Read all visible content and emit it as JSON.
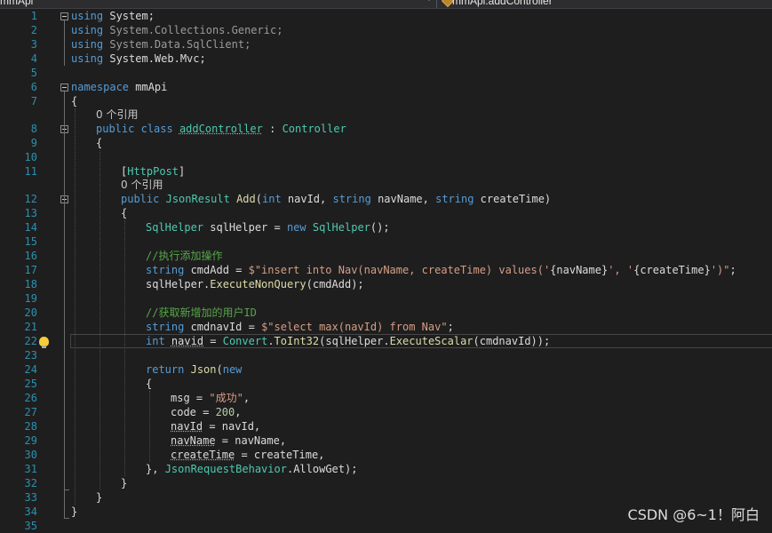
{
  "navbar": {
    "project_dropdown": "mmApi",
    "class_dropdown": "mmApi.addController"
  },
  "editor": {
    "line_numbers": [
      "1",
      "2",
      "3",
      "4",
      "5",
      "6",
      "7",
      "8",
      "9",
      "10",
      "11",
      "12",
      "13",
      "14",
      "15",
      "16",
      "17",
      "18",
      "19",
      "20",
      "21",
      "22",
      "23",
      "24",
      "25",
      "26",
      "27",
      "28",
      "29",
      "30",
      "31",
      "32",
      "33",
      "34",
      "35"
    ],
    "codelens_class": "0 个引用",
    "codelens_method": "0 个引用",
    "lines": {
      "l1": [
        "using",
        " System;"
      ],
      "l2": [
        "using",
        " System.Collections.Generic;"
      ],
      "l3": [
        "using",
        " System.Data.SqlClient;"
      ],
      "l4": [
        "using",
        " System.Web.Mvc;"
      ],
      "l6": [
        "namespace",
        " mmApi"
      ],
      "l7": "{",
      "l8": [
        "public",
        " ",
        "class",
        " ",
        "addController",
        " : ",
        "Controller"
      ],
      "l9": "{",
      "l11": [
        "[",
        "HttpPost",
        "]"
      ],
      "l12": [
        "public",
        " ",
        "JsonResult",
        " ",
        "Add",
        "(",
        "int",
        " navId, ",
        "string",
        " navName, ",
        "string",
        " createTime)"
      ],
      "l13": "{",
      "l14": [
        "SqlHelper",
        " sqlHelper = ",
        "new",
        " ",
        "SqlHelper",
        "();"
      ],
      "l16": "//执行添加操作",
      "l17": [
        "string",
        " cmdAdd = ",
        "$\"insert into Nav(navName, createTime) values('",
        "{navName}",
        "', '",
        "{createTime}",
        "')\"",
        ";"
      ],
      "l18": [
        "sqlHelper.",
        "ExecuteNonQuery",
        "(cmdAdd);"
      ],
      "l20": "//获取新增加的用户ID",
      "l21": [
        "string",
        " cmdnavId = ",
        "$\"select max(navId) from Nav\"",
        ";"
      ],
      "l22": [
        "int",
        " ",
        "navid",
        " = ",
        "Convert",
        ".",
        "ToInt32",
        "(sqlHelper.",
        "ExecuteScalar",
        "(cmdnavId));"
      ],
      "l24": [
        "return",
        " ",
        "Json",
        "(",
        "new"
      ],
      "l25": "{",
      "l26": [
        "msg = ",
        "\"成功\"",
        ","
      ],
      "l27": [
        "code = ",
        "200",
        ","
      ],
      "l28": [
        "navId",
        " = navId,"
      ],
      "l29": [
        "navName",
        " = navName,"
      ],
      "l30": [
        "createTime",
        " = createTime,"
      ],
      "l31": [
        "}, ",
        "JsonRequestBehavior",
        ".AllowGet);"
      ],
      "l32": "}",
      "l33": "}",
      "l34": "}"
    },
    "current_line": "22"
  },
  "watermark": "CSDN @6~1！阿白",
  "colors": {
    "background": "#1e1e1e",
    "line_number": "#2b91af",
    "keyword": "#569cd6",
    "type": "#4ec9b0",
    "method": "#dcdcaa",
    "string": "#d69d85",
    "comment": "#57a64a",
    "number": "#b5cea8"
  },
  "icons": [
    "lightbulb-icon",
    "collapse-icon",
    "class-icon",
    "chevron-down-icon"
  ]
}
